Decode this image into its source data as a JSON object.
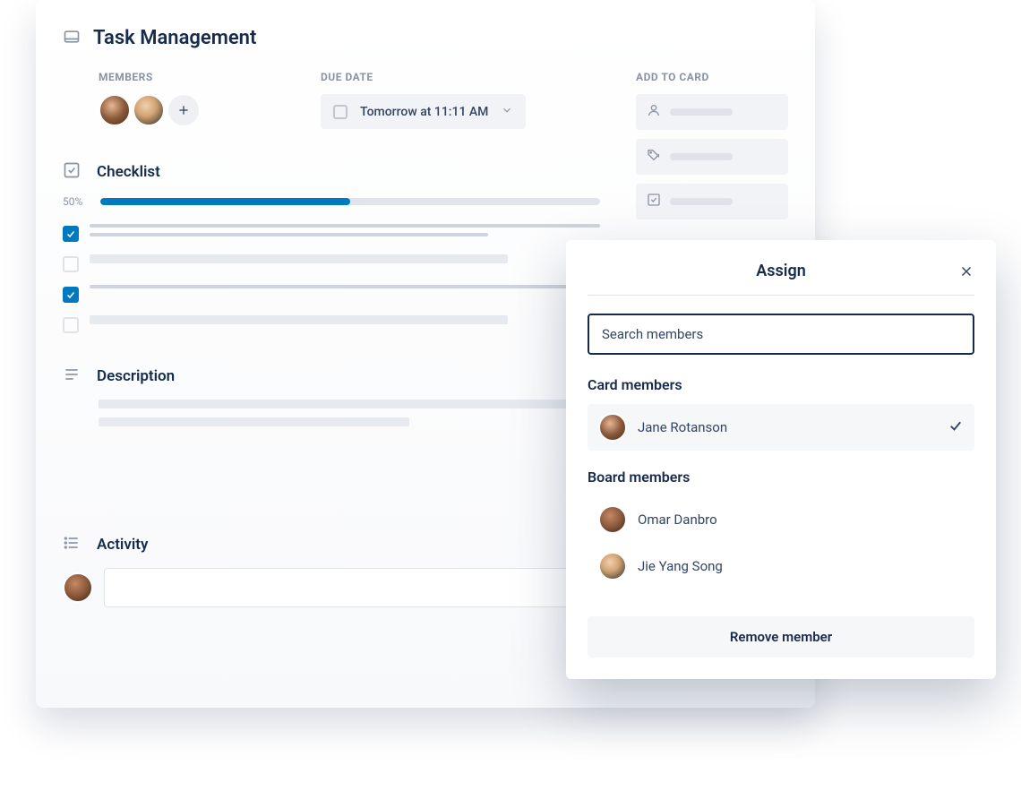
{
  "card": {
    "title": "Task Management",
    "members_label": "MEMBERS",
    "due_date_label": "DUE DATE",
    "due_date_value": "Tomorrow at 11:11 AM",
    "add_to_card_label": "ADD TO CARD",
    "checklist": {
      "title": "Checklist",
      "progress_label": "50%",
      "progress_percent": 50,
      "items": [
        {
          "checked": true
        },
        {
          "checked": false
        },
        {
          "checked": true
        },
        {
          "checked": false
        }
      ]
    },
    "description": {
      "title": "Description"
    },
    "activity": {
      "title": "Activity"
    }
  },
  "sidebar_items": [
    {
      "icon": "person"
    },
    {
      "icon": "tag"
    },
    {
      "icon": "checklist"
    }
  ],
  "assign_popup": {
    "title": "Assign",
    "search_placeholder": "Search members",
    "card_members_label": "Card members",
    "board_members_label": "Board members",
    "card_members": [
      {
        "name": "Jane Rotanson",
        "selected": true
      }
    ],
    "board_members": [
      {
        "name": "Omar Danbro"
      },
      {
        "name": "Jie Yang Song"
      }
    ],
    "remove_button": "Remove member"
  },
  "colors": {
    "primary": "#0079bf",
    "text_dark": "#172b4d",
    "text_muted": "#8993a4"
  }
}
